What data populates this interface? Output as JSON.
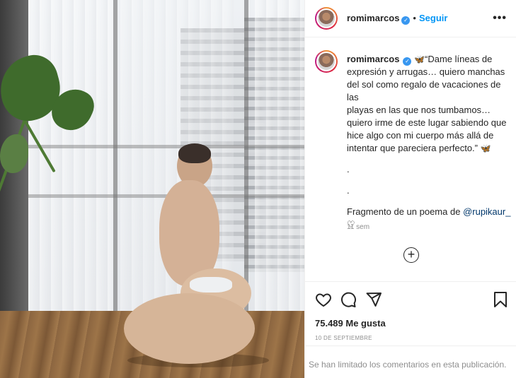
{
  "post": {
    "username": "romimarcos",
    "verified_mark": "✓",
    "separator": "•",
    "follow_label": "Seguir",
    "more_label": "•••"
  },
  "caption": {
    "username": "romimarcos",
    "emoji": "🦋",
    "lines": [
      "“Dame líneas de",
      "expresión y arrugas… quiero manchas",
      "del sol como regalo de vacaciones de las",
      "playas en las que nos tumbamos…",
      "quiero irme de este lugar sabiendo que",
      "hice algo con mi cuerpo más allá de",
      "intentar que pareciera perfecto.”"
    ],
    "dot1": ".",
    "dot2": ".",
    "fragment_prefix": "Fragmento de un poema de ",
    "mention": "@rupikaur_",
    "heart": "♡",
    "time": "11 sem",
    "load_more": "+"
  },
  "actions": {
    "like_icon": "heart-icon",
    "comment_icon": "comment-icon",
    "share_icon": "send-icon",
    "save_icon": "bookmark-icon",
    "likes": "75.489 Me gusta",
    "date": "10 DE SEPTIEMBRE"
  },
  "footer": {
    "comments_limited": "Se han limitado los comentarios en esta publicación."
  },
  "colors": {
    "link": "#0095f6",
    "mention": "#00376b",
    "muted": "#8e8e8e",
    "text": "#262626"
  }
}
